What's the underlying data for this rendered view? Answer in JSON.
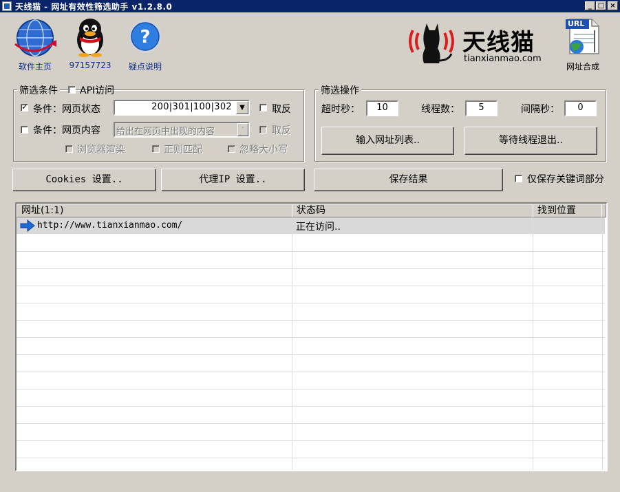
{
  "window": {
    "title": "天线猫 - 网址有效性筛选助手 v1.2.8.0",
    "min_label": "_",
    "max_label": "□",
    "close_label": "×"
  },
  "toolbar": [
    {
      "label": "软件主页",
      "icon": "globe-icon"
    },
    {
      "label": "97157723",
      "icon": "qq-penguin-icon"
    },
    {
      "label": "疑点说明",
      "icon": "help-icon"
    }
  ],
  "brand": {
    "name": "天线猫",
    "domain": "tianxianmao.com",
    "accent": "#d81e1e"
  },
  "url_merge": {
    "label": "网址合成",
    "badge": "URL"
  },
  "filter": {
    "group_title": "筛选条件",
    "api_label": "API访问",
    "cond1_label": "条件：网页状态",
    "cond1_value": "200|301|100|302",
    "cond1_invert": "取反",
    "cond2_label": "条件：网页内容",
    "cond2_placeholder": "给出在网页中出现的内容",
    "cond2_invert": "取反",
    "opt_browser": "浏览器渲染",
    "opt_regex": "正则匹配",
    "opt_ignorecase": "忽略大小写"
  },
  "ops": {
    "group_title": "筛选操作",
    "timeout_label": "超时秒：",
    "timeout_value": "10",
    "threads_label": "线程数：",
    "threads_value": "5",
    "interval_label": "间隔秒：",
    "interval_value": "0",
    "input_btn": "输入网址列表..",
    "wait_btn": "等待线程退出.."
  },
  "buttons": {
    "cookies": "Cookies 设置..",
    "proxy": "代理IP 设置..",
    "save": "保存结果",
    "keyword_only": "仅保存关键词部分"
  },
  "table": {
    "columns": [
      "网址(1:1)",
      "状态码",
      "找到位置"
    ],
    "rows": [
      {
        "url": "http://www.tianxianmao.com/",
        "status": "正在访问..",
        "pos": ""
      }
    ]
  }
}
